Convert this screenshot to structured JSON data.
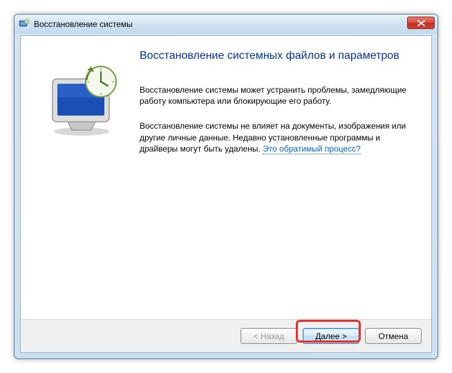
{
  "window": {
    "title": "Восстановление системы"
  },
  "main": {
    "heading": "Восстановление системных файлов и параметров",
    "para1": "Восстановление системы может устранить проблемы, замедляющие работу компьютера или блокирующие его работу.",
    "para2_pre": "Восстановление системы не влияет на документы, изображения или другие личные данные. Недавно установленные программы и драйверы могут быть удалены. ",
    "para2_link": "Это обратимый процесс?"
  },
  "buttons": {
    "back": "< Назад",
    "next": "Далее >",
    "cancel": "Отмена"
  }
}
